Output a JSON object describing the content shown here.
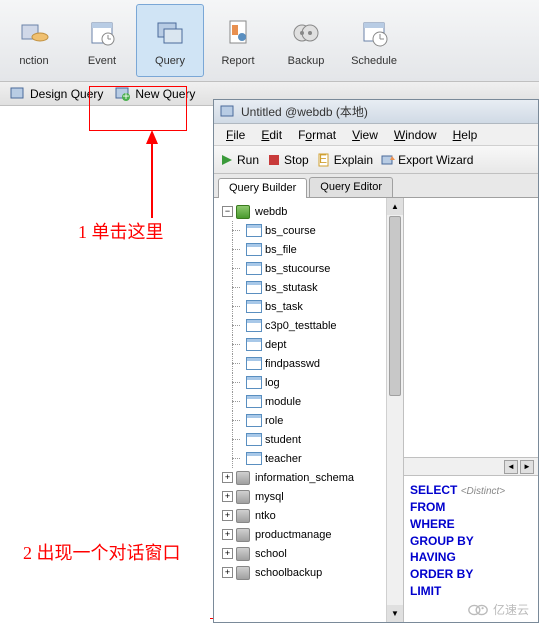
{
  "toolbar": {
    "items": [
      {
        "label": "nction",
        "name": "function-button"
      },
      {
        "label": "Event",
        "name": "event-button"
      },
      {
        "label": "Query",
        "name": "query-button"
      },
      {
        "label": "Report",
        "name": "report-button"
      },
      {
        "label": "Backup",
        "name": "backup-button"
      },
      {
        "label": "Schedule",
        "name": "schedule-button"
      }
    ],
    "selected_index": 2
  },
  "secondary": {
    "design_query": "Design Query",
    "new_query": "New Query"
  },
  "annotations": {
    "ann1": "1 单击这里",
    "ann2": "2 出现一个对话窗口"
  },
  "dialog": {
    "title": "Untitled @webdb (本地)",
    "menus": [
      "File",
      "Edit",
      "Format",
      "View",
      "Window",
      "Help"
    ],
    "actions": {
      "run": "Run",
      "stop": "Stop",
      "explain": "Explain",
      "export_wizard": "Export Wizard"
    },
    "tabs": [
      "Query Builder",
      "Query Editor"
    ],
    "active_tab": 0,
    "tree": {
      "root": "webdb",
      "tables": [
        "bs_course",
        "bs_file",
        "bs_stucourse",
        "bs_stutask",
        "bs_task",
        "c3p0_testtable",
        "dept",
        "findpasswd",
        "log",
        "module",
        "role",
        "student",
        "teacher"
      ],
      "other_dbs": [
        "information_schema",
        "mysql",
        "ntko",
        "productmanage",
        "school",
        "schoolbackup"
      ]
    },
    "sql": {
      "select": "SELECT",
      "distinct": "<Distinct>",
      "from": "FROM",
      "where": "WHERE",
      "group_by": "GROUP BY",
      "having": "HAVING",
      "order_by": "ORDER BY",
      "limit": "LIMIT"
    }
  },
  "watermark": "亿速云"
}
